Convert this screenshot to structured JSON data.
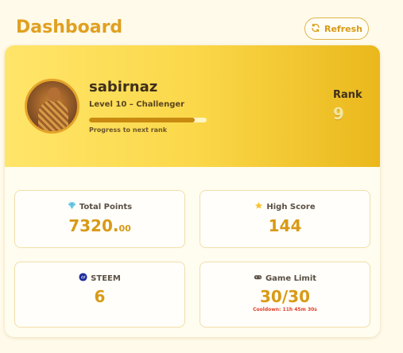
{
  "header": {
    "title": "Dashboard",
    "refresh_label": "Refresh"
  },
  "profile": {
    "username": "sabirnaz",
    "level_text": "Level 10 – Challenger",
    "progress_label": "Progress to next rank",
    "progress_fraction": 0.9,
    "rank_label": "Rank",
    "rank_value": "9"
  },
  "stats": {
    "total_points": {
      "icon": "gem-icon",
      "label": "Total Points",
      "value_main": "7320.",
      "value_decimal": "00"
    },
    "high_score": {
      "icon": "star-icon",
      "label": "High Score",
      "value": "144"
    },
    "steem": {
      "icon": "steem-icon",
      "label": "STEEM",
      "value": "6"
    },
    "game_limit": {
      "icon": "gamepad-icon",
      "label": "Game Limit",
      "value": "30/30",
      "cooldown": "Cooldown: 11h 45m 30s"
    }
  },
  "colors": {
    "accent": "#d89a16",
    "background": "#fffaea",
    "cooldown": "#e0402a"
  }
}
